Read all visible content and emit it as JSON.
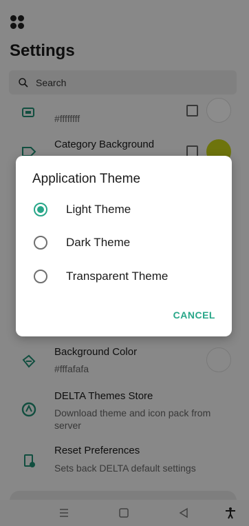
{
  "app": {
    "title": "Settings"
  },
  "search": {
    "placeholder": "Search"
  },
  "settings_rows": [
    {
      "title": "",
      "subtitle": "#ffffffff"
    },
    {
      "title": "Category Background",
      "subtitle": ""
    },
    {
      "title": "Background Color",
      "subtitle": "#fffafafa"
    },
    {
      "title": "DELTA Themes Store",
      "subtitle": "Download theme and icon pack from server"
    },
    {
      "title": "Reset Preferences",
      "subtitle": "Sets back DELTA default settings"
    }
  ],
  "dialog": {
    "title": "Application Theme",
    "options": [
      {
        "label": "Light Theme",
        "selected": true
      },
      {
        "label": "Dark Theme",
        "selected": false
      },
      {
        "label": "Transparent Theme",
        "selected": false
      }
    ],
    "cancel_label": "CANCEL"
  },
  "colors": {
    "accent": "#27a688",
    "category_background_swatch": "#c8d416",
    "icon_tint": "#1f8f74"
  },
  "icons": {
    "menu": "apps-grid-icon",
    "search": "search-icon",
    "row_0": "palette-icon",
    "row_1": "label-icon",
    "row_2": "paint-bucket-icon",
    "row_3": "store-icon",
    "row_4": "reset-icon"
  }
}
